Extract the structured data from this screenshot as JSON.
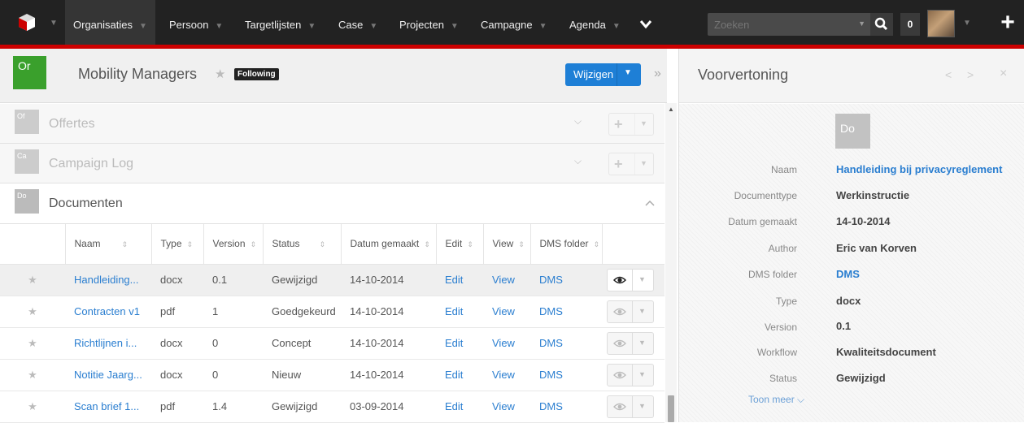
{
  "nav": {
    "tabs": [
      "Organisaties",
      "Persoon",
      "Targetlijsten",
      "Case",
      "Projecten",
      "Campagne",
      "Agenda"
    ],
    "search_placeholder": "Zoeken",
    "notification_count": "0",
    "colors": {
      "bar": "#222222",
      "accent": "#cc0000"
    }
  },
  "record": {
    "badge": "Or",
    "title": "Mobility Managers",
    "following_label": "Following",
    "edit_label": "Wijzigen",
    "badge_color": "#3aa02c",
    "button_color": "#1e7fd6"
  },
  "subpanels": [
    {
      "badge": "Of",
      "name": "Offertes"
    },
    {
      "badge": "Ca",
      "name": "Campaign Log"
    },
    {
      "badge": "Do",
      "name": "Documenten"
    }
  ],
  "documents": {
    "columns": [
      "Naam",
      "Type",
      "Version",
      "Status",
      "Datum gemaakt",
      "Edit",
      "View",
      "DMS folder"
    ],
    "rows": [
      {
        "name": "Handleiding...",
        "type": "docx",
        "version": "0.1",
        "status": "Gewijzigd",
        "date": "14-10-2014",
        "edit": "Edit",
        "view": "View",
        "dms": "DMS"
      },
      {
        "name": "Contracten v1",
        "type": "pdf",
        "version": "1",
        "status": "Goedgekeurd",
        "date": "14-10-2014",
        "edit": "Edit",
        "view": "View",
        "dms": "DMS"
      },
      {
        "name": "Richtlijnen i...",
        "type": "docx",
        "version": "0",
        "status": "Concept",
        "date": "14-10-2014",
        "edit": "Edit",
        "view": "View",
        "dms": "DMS"
      },
      {
        "name": "Notitie Jaarg...",
        "type": "docx",
        "version": "0",
        "status": "Nieuw",
        "date": "14-10-2014",
        "edit": "Edit",
        "view": "View",
        "dms": "DMS"
      },
      {
        "name": "Scan brief 1...",
        "type": "pdf",
        "version": "1.4",
        "status": "Gewijzigd",
        "date": "03-09-2014",
        "edit": "Edit",
        "view": "View",
        "dms": "DMS"
      }
    ]
  },
  "preview": {
    "title": "Voorvertoning",
    "badge": "Do",
    "fields": [
      {
        "label": "Naam",
        "value": "Handleiding bij privacyreglement"
      },
      {
        "label": "Documenttype",
        "value": "Werkinstructie"
      },
      {
        "label": "Datum gemaakt",
        "value": "14-10-2014"
      },
      {
        "label": "Author",
        "value": "Eric van Korven"
      },
      {
        "label": "DMS folder",
        "value": "DMS"
      },
      {
        "label": "Type",
        "value": "docx"
      },
      {
        "label": "Version",
        "value": "0.1"
      },
      {
        "label": "Workflow",
        "value": "Kwaliteitsdocument"
      },
      {
        "label": "Status",
        "value": "Gewijzigd"
      }
    ],
    "more_label": "Toon meer"
  }
}
